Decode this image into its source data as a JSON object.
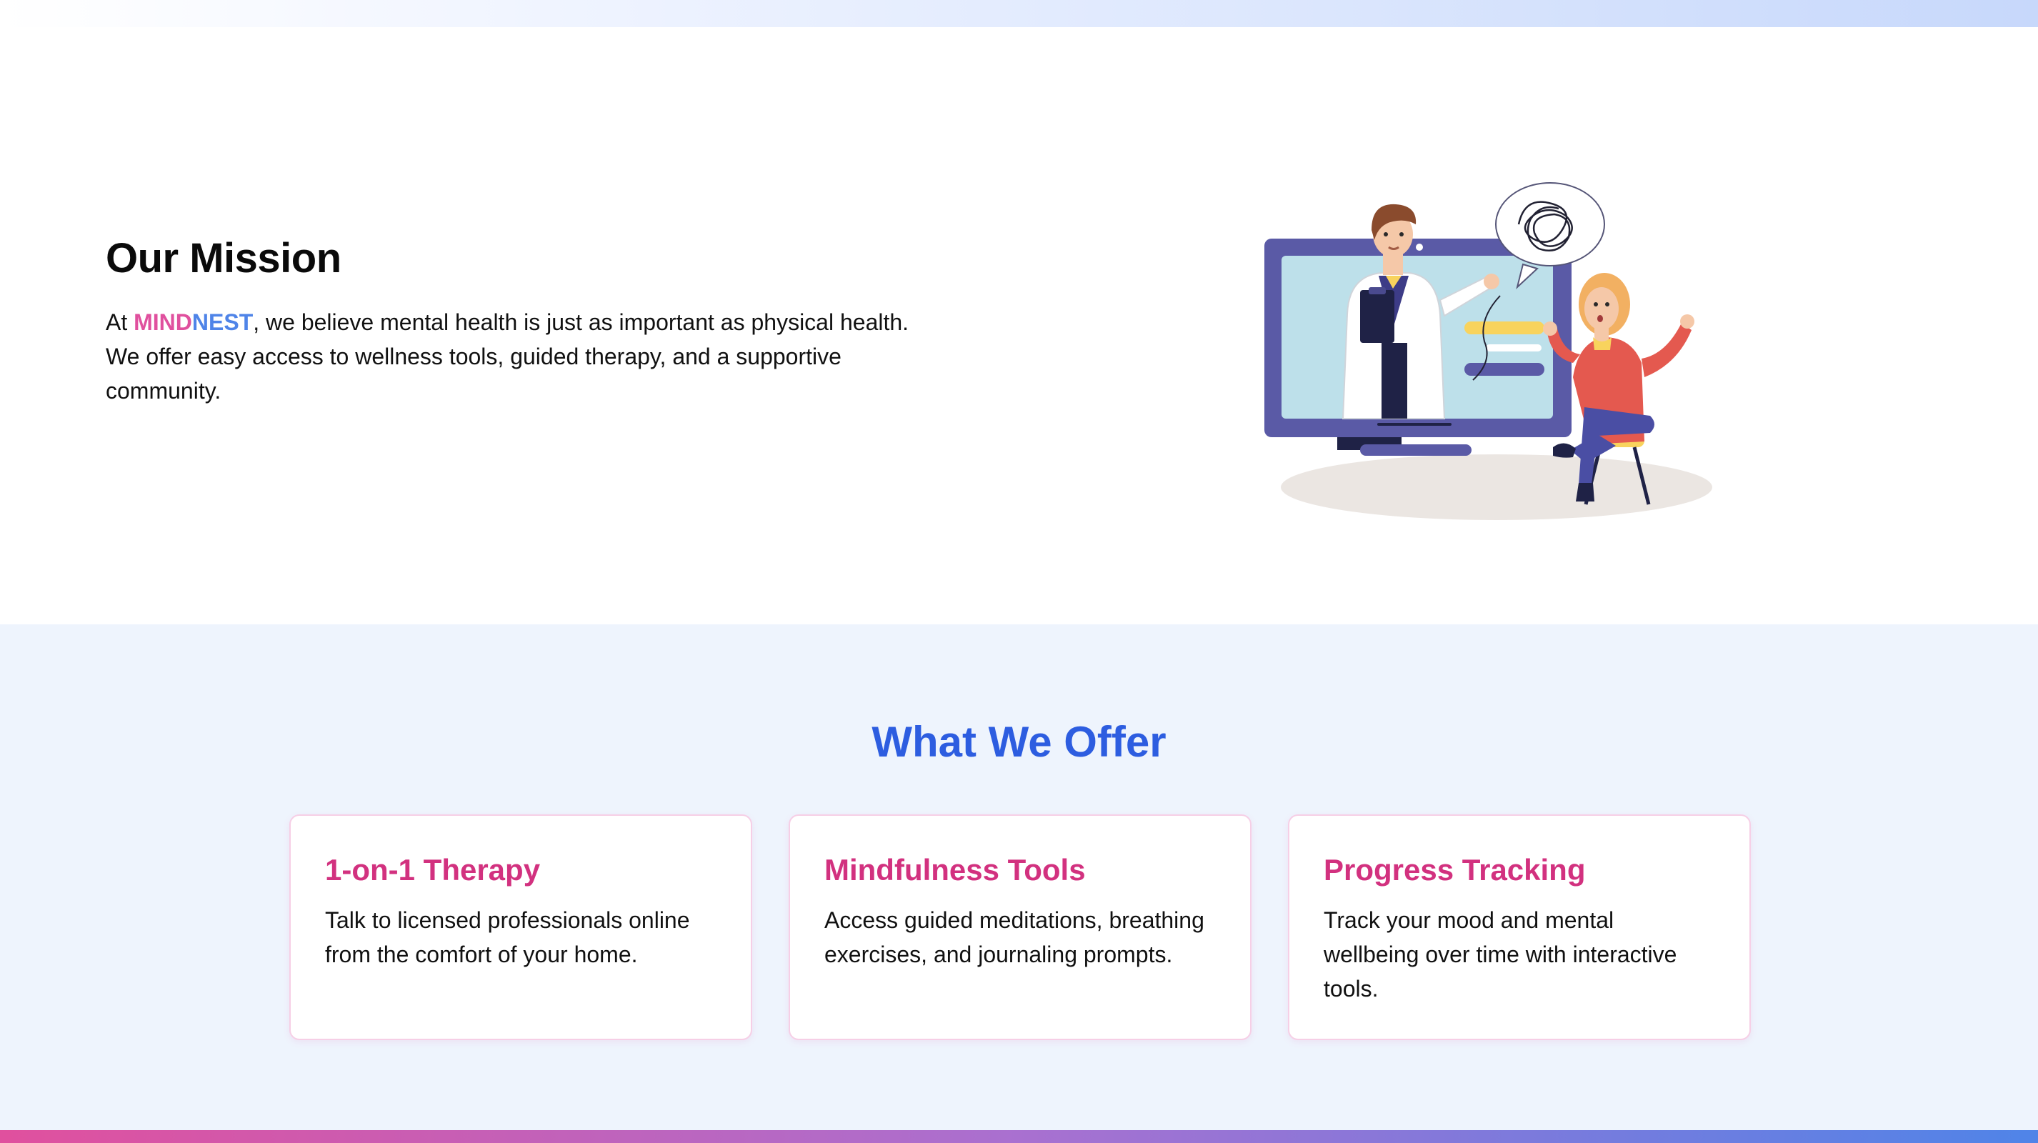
{
  "mission": {
    "title": "Our Mission",
    "intro": "At ",
    "brand_mind": "MIND",
    "brand_nest": "NEST",
    "body": ", we believe mental health is just as important as physical health. We offer easy access to wellness tools, guided therapy, and a supportive community."
  },
  "offer": {
    "title": "What We Offer",
    "cards": [
      {
        "title": "1-on-1 Therapy",
        "description": "Talk to licensed professionals online from the comfort of your home."
      },
      {
        "title": "Mindfulness Tools",
        "description": "Access guided meditations, breathing exercises, and journaling prompts."
      },
      {
        "title": "Progress Tracking",
        "description": "Track your mood and mental wellbeing over time with interactive tools."
      }
    ]
  },
  "colors": {
    "brand_pink": "#e0509e",
    "brand_blue": "#4f84e8",
    "heading_blue": "#2d5de0",
    "card_title": "#d2317f",
    "offer_bg": "#eef4fd"
  }
}
